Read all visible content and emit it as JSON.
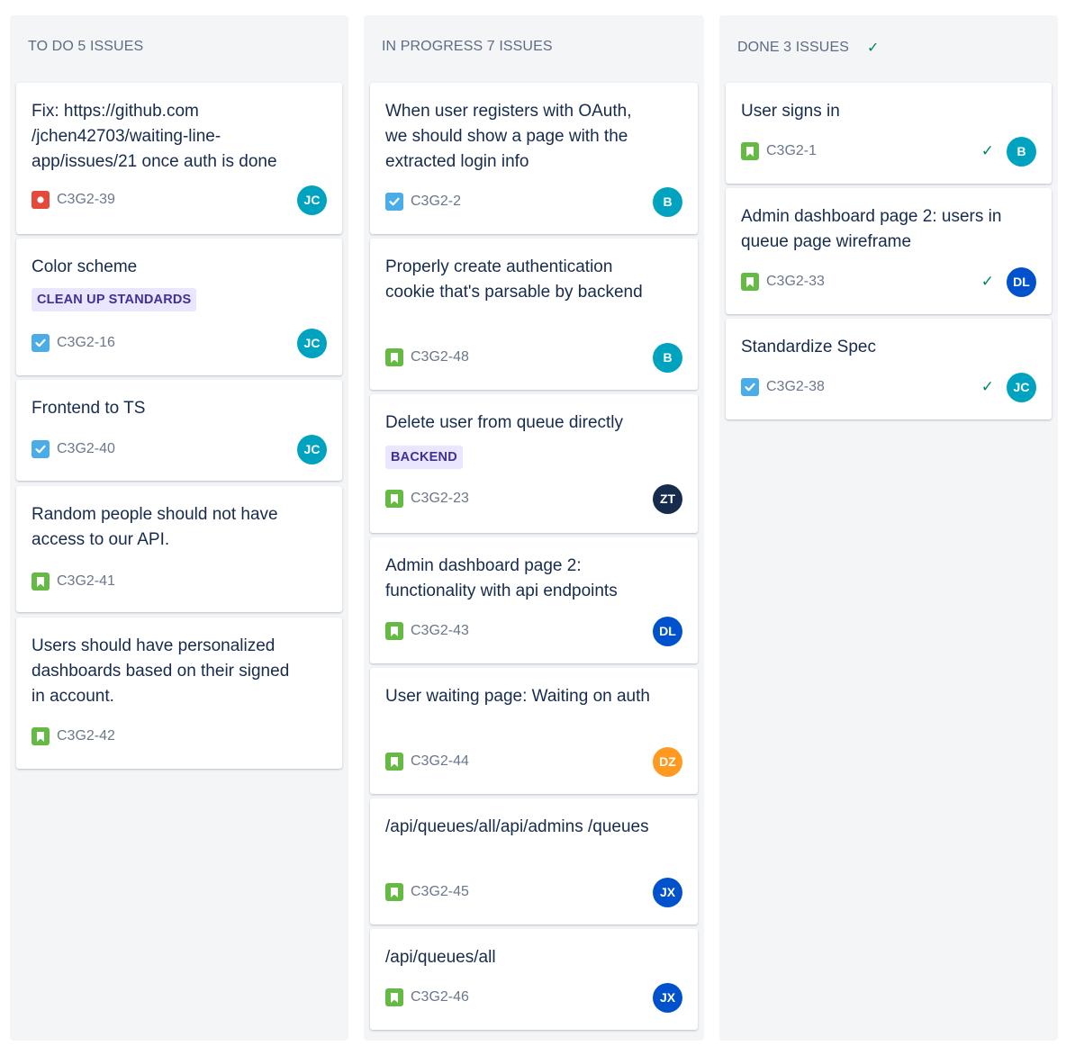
{
  "columns": [
    {
      "name": "TO DO 5 ISSUES",
      "cards": [
        {
          "title": "Fix: https://github.com /jchen42703/waiting-line-app/issues/21 once auth is done",
          "key": "C3G2-39",
          "type": "bug-icon",
          "assignee": "JC"
        },
        {
          "title": "Color scheme",
          "label": "CLEAN UP STANDARDS",
          "key": "C3G2-16",
          "type": "task-icon",
          "assignee": "JC"
        },
        {
          "title": "Frontend to TS",
          "key": "C3G2-40",
          "type": "task-icon",
          "assignee": "JC"
        },
        {
          "title": "Random people should not have access to our API.",
          "key": "C3G2-41",
          "type": "story-icon"
        },
        {
          "title": "Users should have personalized dashboards based on their signed in account.",
          "key": "C3G2-42",
          "type": "story-icon"
        }
      ]
    },
    {
      "name": "IN PROGRESS 7 ISSUES",
      "cards": [
        {
          "title": "When user registers with OAuth, we should show a page with the extracted login info",
          "key": "C3G2-2",
          "type": "task-icon",
          "assignee": "B"
        },
        {
          "title": "Properly create authentication cookie that's parsable by backend",
          "key": "C3G2-48",
          "type": "story-icon",
          "assignee": "B"
        },
        {
          "title": "Delete user from queue directly",
          "label": "BACKEND",
          "key": "C3G2-23",
          "type": "story-icon",
          "assignee": "ZT"
        },
        {
          "title": "Admin dashboard page 2: functionality with api endpoints",
          "key": "C3G2-43",
          "type": "story-icon",
          "assignee": "DL"
        },
        {
          "title": "User waiting page: Waiting on auth",
          "key": "C3G2-44",
          "type": "story-icon",
          "assignee": "DZ"
        },
        {
          "title": "/api/queues/all/api/admins /queues",
          "key": "C3G2-45",
          "type": "story-icon",
          "assignee": "JX"
        },
        {
          "title": "/api/queues/all",
          "key": "C3G2-46",
          "type": "story-icon",
          "assignee": "JX"
        }
      ]
    },
    {
      "name": "DONE 3 ISSUES",
      "cards": [
        {
          "title": "User signs in",
          "key": "C3G2-1",
          "type": "story-icon",
          "assignee": "B"
        },
        {
          "title": "Admin dashboard page 2: users in queue page wireframe",
          "key": "C3G2-33",
          "type": "story-icon",
          "assignee": "DL"
        },
        {
          "title": "Standardize Spec",
          "key": "C3G2-38",
          "type": "task-icon",
          "assignee": "JC"
        }
      ]
    }
  ],
  "avatar_colors": {
    "JC": "#00a3bf",
    "B": "#00a3bf",
    "ZT": "#172b4d",
    "DL": "#0052cc",
    "DZ": "#ff991f",
    "JX": "#0052cc"
  },
  "colors": {
    "column_bg": "#f4f5f7",
    "done_check": "#00875a",
    "label_bg": "#eae6ff",
    "label_text": "#403294"
  }
}
